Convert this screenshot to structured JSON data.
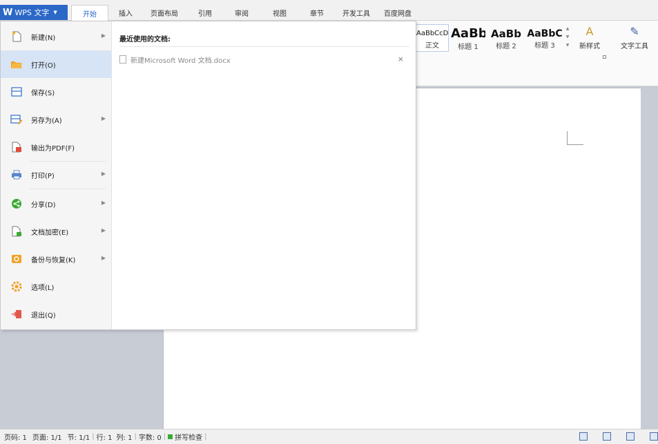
{
  "app": {
    "name": "WPS 文字"
  },
  "menu_tabs": [
    "开始",
    "插入",
    "页面布局",
    "引用",
    "审阅",
    "视图",
    "章节",
    "开发工具",
    "百度网盘"
  ],
  "ribbon": {
    "styles": [
      {
        "sample": "AaBbCcDd",
        "caption": "正文"
      },
      {
        "sample": "AaBb",
        "caption": "标题 1"
      },
      {
        "sample": "AaBb",
        "caption": "标题 2"
      },
      {
        "sample": "AaBbC",
        "caption": "标题 3"
      }
    ],
    "new_style_label": "新样式",
    "text_tools_label": "文字工具"
  },
  "file_menu": {
    "items": [
      {
        "label": "新建(N)",
        "icon": "new-document-icon"
      },
      {
        "label": "打开(O)",
        "icon": "open-folder-icon"
      },
      {
        "label": "保存(S)",
        "icon": "save-icon"
      },
      {
        "label": "另存为(A)",
        "icon": "save-as-icon"
      },
      {
        "label": "输出为PDF(F)",
        "icon": "export-pdf-icon"
      },
      {
        "label": "打印(P)",
        "icon": "print-icon"
      },
      {
        "label": "分享(D)",
        "icon": "share-icon"
      },
      {
        "label": "文档加密(E)",
        "icon": "encrypt-icon"
      },
      {
        "label": "备份与恢复(K)",
        "icon": "backup-icon"
      },
      {
        "label": "选项(L)",
        "icon": "gear-icon"
      },
      {
        "label": "退出(Q)",
        "icon": "exit-icon"
      }
    ],
    "recent_title": "最近使用的文档:",
    "recent_files": [
      "新建Microsoft Word 文档.docx"
    ]
  },
  "statusbar": {
    "page_code": "页码: 1",
    "pages": "页面: 1/1",
    "section": "节: 1/1",
    "row": "行: 1",
    "col": "列: 1",
    "word_count": "字数: 0",
    "spell_check": "拼写检查"
  },
  "colors": {
    "accent": "#2b68c7",
    "selected": "#d6e4f5"
  }
}
